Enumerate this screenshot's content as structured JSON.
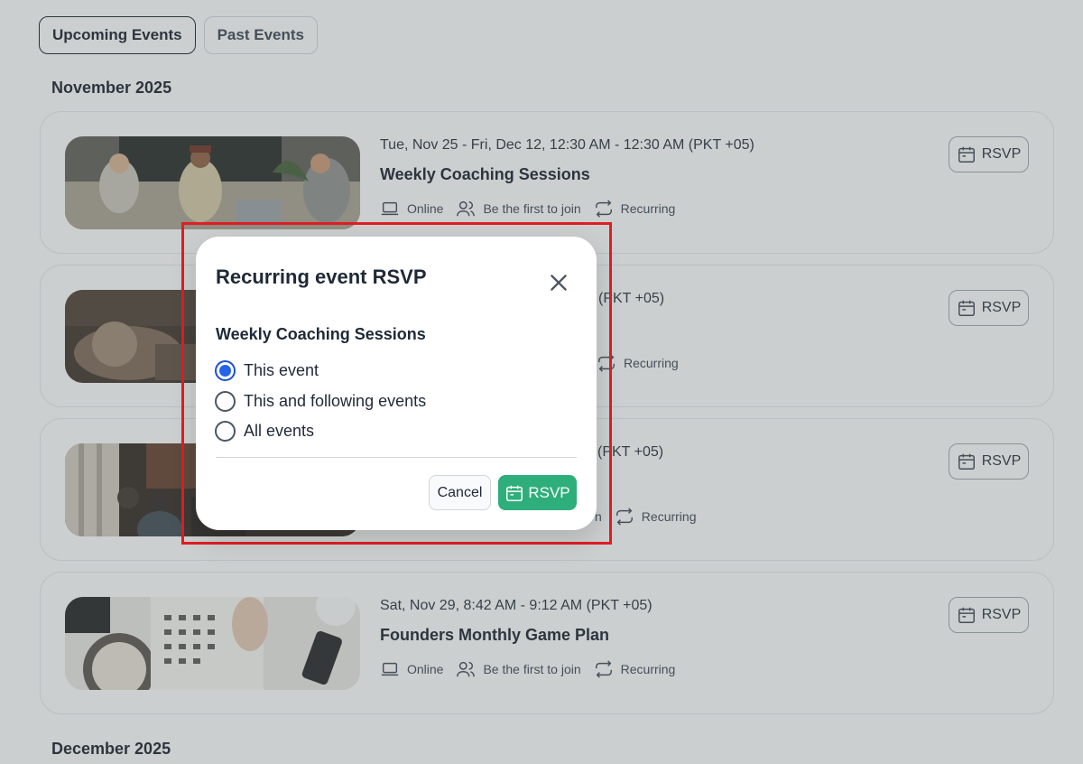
{
  "tabs": [
    {
      "label": "Upcoming Events",
      "active": true
    },
    {
      "label": "Past Events",
      "active": false
    }
  ],
  "months": [
    "November 2025",
    "December 2025"
  ],
  "events": [
    {
      "when": "Tue, Nov 25 - Fri, Dec 12, 12:30 AM - 12:30 AM (PKT +05)",
      "title": "Weekly Coaching Sessions",
      "location": "Online",
      "attendees": "Be the first to join",
      "recurrence": "Recurring",
      "rsvp_label": "RSVP"
    },
    {
      "when": "(PKT +05)",
      "title": "",
      "location": "",
      "attendees": "",
      "recurrence": "Recurring",
      "rsvp_label": "RSVP"
    },
    {
      "when": "(PKT +05)",
      "title": "",
      "location": "",
      "attendees": "n",
      "recurrence": "Recurring",
      "rsvp_label": "RSVP"
    },
    {
      "when": "Sat, Nov 29, 8:42 AM - 9:12 AM (PKT +05)",
      "title": "Founders Monthly Game Plan",
      "location": "Online",
      "attendees": "Be the first to join",
      "recurrence": "Recurring",
      "rsvp_label": "RSVP"
    }
  ],
  "modal": {
    "title": "Recurring event RSVP",
    "event_name": "Weekly Coaching Sessions",
    "options": [
      {
        "label": "This event",
        "selected": true
      },
      {
        "label": "This and following events",
        "selected": false
      },
      {
        "label": "All events",
        "selected": false
      }
    ],
    "cancel_label": "Cancel",
    "confirm_label": "RSVP"
  },
  "colors": {
    "accent_green": "#2eae7b",
    "radio_blue": "#2563eb",
    "highlight_red": "#e11d24"
  },
  "icons": [
    "calendar-icon",
    "laptop-icon",
    "users-icon",
    "repeat-icon",
    "close-icon"
  ]
}
